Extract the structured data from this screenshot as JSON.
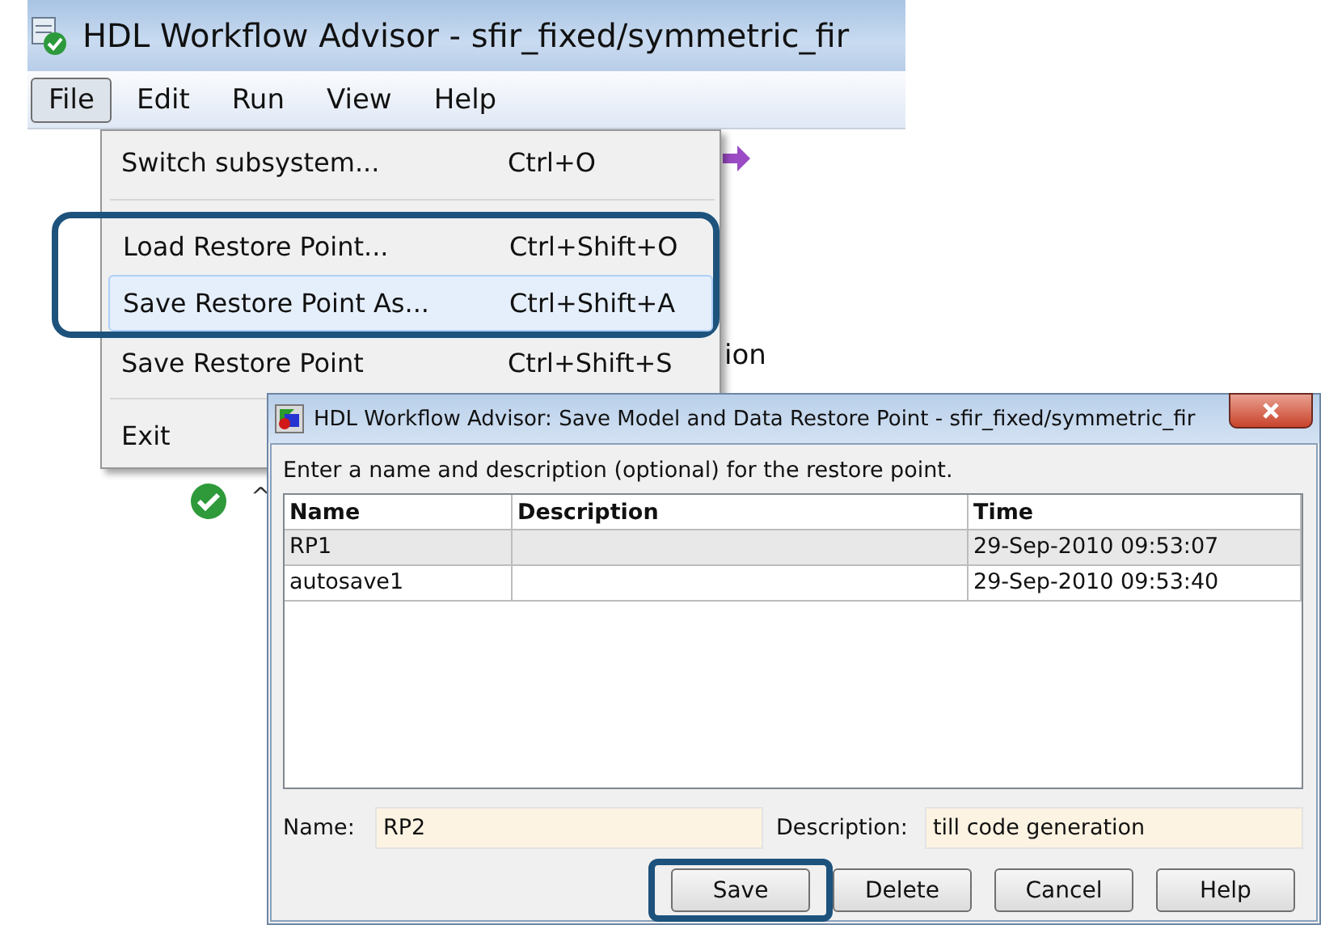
{
  "main_window": {
    "title": "HDL Workflow Advisor - sfir_fixed/symmetric_fir",
    "menu": [
      {
        "label": "File",
        "selected": true
      },
      {
        "label": "Edit",
        "selected": false
      },
      {
        "label": "Run",
        "selected": false
      },
      {
        "label": "View",
        "selected": false
      },
      {
        "label": "Help",
        "selected": false
      }
    ],
    "partial_text": "ion",
    "tree_caret": "^"
  },
  "file_menu": [
    {
      "kind": "item",
      "label": "Switch subsystem...",
      "shortcut": "Ctrl+O",
      "selected": false,
      "highlighted": false
    },
    {
      "kind": "separator"
    },
    {
      "kind": "item",
      "label": "Load Restore Point...",
      "shortcut": "Ctrl+Shift+O",
      "selected": false,
      "highlighted": true
    },
    {
      "kind": "item",
      "label": "Save Restore Point As...",
      "shortcut": "Ctrl+Shift+A",
      "selected": true,
      "highlighted": true
    },
    {
      "kind": "item",
      "label": "Save Restore Point",
      "shortcut": "Ctrl+Shift+S",
      "selected": false,
      "highlighted": false
    },
    {
      "kind": "separator"
    },
    {
      "kind": "item",
      "label": "Exit",
      "selected": false,
      "highlighted": false
    }
  ],
  "dialog": {
    "title": "HDL Workflow Advisor: Save Model and Data Restore Point - sfir_fixed/symmetric_fir",
    "instruction": "Enter a name and description (optional) for the restore point.",
    "table": {
      "columns": [
        "Name",
        "Description",
        "Time"
      ],
      "rows": [
        {
          "name": "RP1",
          "time": "29-Sep-2010 09:53:07",
          "selected": true
        },
        {
          "name": "autosave1",
          "time": "29-Sep-2010 09:53:40",
          "selected": false
        }
      ]
    },
    "name_field": {
      "label": "Name:",
      "value": "RP2"
    },
    "description_field": {
      "label": "Description:",
      "value": "till code generation"
    },
    "buttons": [
      {
        "label": "Save",
        "highlighted": true
      },
      {
        "label": "Delete",
        "highlighted": false
      },
      {
        "label": "Cancel",
        "highlighted": false
      },
      {
        "label": "Help",
        "highlighted": false
      }
    ]
  }
}
